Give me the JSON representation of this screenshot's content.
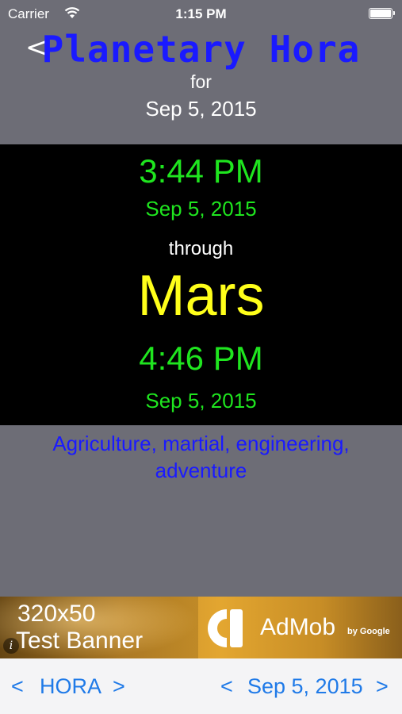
{
  "status_bar": {
    "carrier": "Carrier",
    "time": "1:15 PM"
  },
  "header": {
    "back_label": "<",
    "title": "Planetary Hora",
    "for_label": "for",
    "date": "Sep 5, 2015"
  },
  "hora": {
    "start_time": "3:44 PM",
    "start_date": "Sep 5, 2015",
    "through_label": "through",
    "planet": "Mars",
    "end_time": "4:46 PM",
    "end_date": "Sep 5, 2015"
  },
  "description": "Agriculture, martial, engineering, adventure",
  "ad": {
    "size": "320x50",
    "label": "Test Banner",
    "brand": "AdMob",
    "by": "by Google"
  },
  "bottom_bar": {
    "hora_prev": "<",
    "hora_label": "HORA",
    "hora_next": ">",
    "date_prev": "<",
    "date_label": "Sep 5, 2015",
    "date_next": ">"
  },
  "colors": {
    "background": "#6d6d76",
    "title": "#1a1aff",
    "time_green": "#1fe51f",
    "planet_yellow": "#ffff1a",
    "link_blue": "#1f7ae8"
  }
}
